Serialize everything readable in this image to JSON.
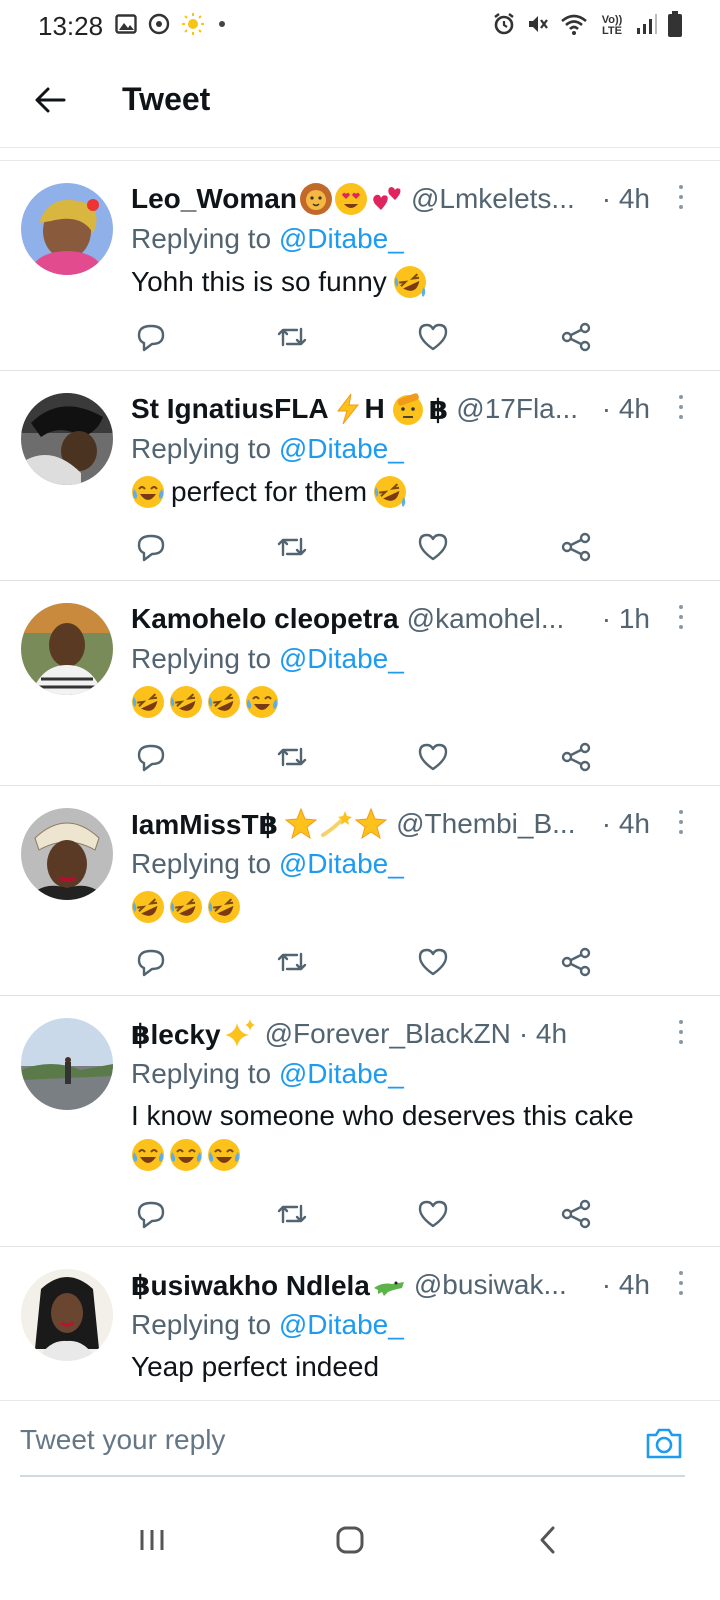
{
  "status_bar": {
    "time": "13:28",
    "left_icons": [
      "gallery-icon",
      "sync-icon",
      "sun-icon",
      "dot-icon"
    ],
    "right_icons": [
      "alarm-icon",
      "mute-icon",
      "wifi-icon",
      "volte-icon",
      "signal-icon",
      "battery-icon"
    ],
    "volte_text": "Vo)) LTE"
  },
  "header": {
    "title": "Tweet",
    "back_icon": "arrow-left-icon"
  },
  "colors": {
    "link": "#1d9bf0",
    "secondary_text": "#536471",
    "primary_text": "#0f1419",
    "divider": "#dfe3e6"
  },
  "replies": [
    {
      "display_name": "Leo_Woman",
      "name_emojis": [
        "lion-face-emoji",
        "heart-eyes-emoji",
        "two-hearts-emoji"
      ],
      "handle": "@Lmkelets...",
      "time": "· 4h",
      "replying_label": "Replying to ",
      "replying_to": "@Ditabe_",
      "text": "Yohh this is so funny",
      "text_emojis_after": [
        "rofl-emoji"
      ],
      "text_emojis_before": []
    },
    {
      "display_name": "St IgnatiusFLA",
      "name_suffix": "H",
      "name_suffix2": "฿",
      "name_emojis": [
        "lightning-emoji"
      ],
      "name_emojis2": [
        "saluting-face-emoji"
      ],
      "handle": "@17Fla...",
      "time": "· 4h",
      "replying_label": "Replying to ",
      "replying_to": "@Ditabe_",
      "text": "perfect for them",
      "text_emojis_before": [
        "joy-emoji"
      ],
      "text_emojis_after": [
        "rofl-emoji"
      ]
    },
    {
      "display_name": "Kamohelo cleopetra",
      "name_emojis": [],
      "handle": "@kamohel...",
      "time": "· 1h",
      "replying_label": "Replying to ",
      "replying_to": "@Ditabe_",
      "text": "",
      "text_emojis_before": [],
      "text_emojis_after": [
        "rofl-emoji",
        "rofl-emoji",
        "rofl-emoji",
        "joy-emoji"
      ]
    },
    {
      "display_name": "IamMissT฿",
      "name_emojis": [
        "star-emoji",
        "dizzy-emoji",
        "star-emoji"
      ],
      "handle": "@Thembi_B...",
      "time": "· 4h",
      "replying_label": "Replying to ",
      "replying_to": "@Ditabe_",
      "text": "",
      "text_emojis_before": [],
      "text_emojis_after": [
        "rofl-emoji",
        "rofl-emoji",
        "rofl-emoji"
      ]
    },
    {
      "display_name": "฿lecky",
      "name_emojis": [
        "sparkles-emoji"
      ],
      "handle": "@Forever_BlackZN",
      "time": "· 4h",
      "replying_label": "Replying to ",
      "replying_to": "@Ditabe_",
      "text": "I know someone who deserves this cake",
      "text_line2_emojis": [
        "joy-emoji",
        "joy-emoji",
        "joy-emoji"
      ],
      "text_emojis_before": [],
      "text_emojis_after": []
    },
    {
      "display_name": "฿usiwakho Ndlela",
      "name_emojis": [
        "crocodile-emoji"
      ],
      "handle": "@busiwak...",
      "time": "· 4h",
      "replying_label": "Replying to ",
      "replying_to": "@Ditabe_",
      "text": "Yeap perfect indeed",
      "text_emojis_before": [],
      "text_emojis_after": []
    }
  ],
  "actions": [
    "reply-icon",
    "retweet-icon",
    "like-icon",
    "share-icon"
  ],
  "composer": {
    "placeholder": "Tweet your reply",
    "camera_icon": "camera-icon"
  },
  "nav_bar": [
    "recents-icon",
    "home-icon",
    "back-nav-icon"
  ]
}
